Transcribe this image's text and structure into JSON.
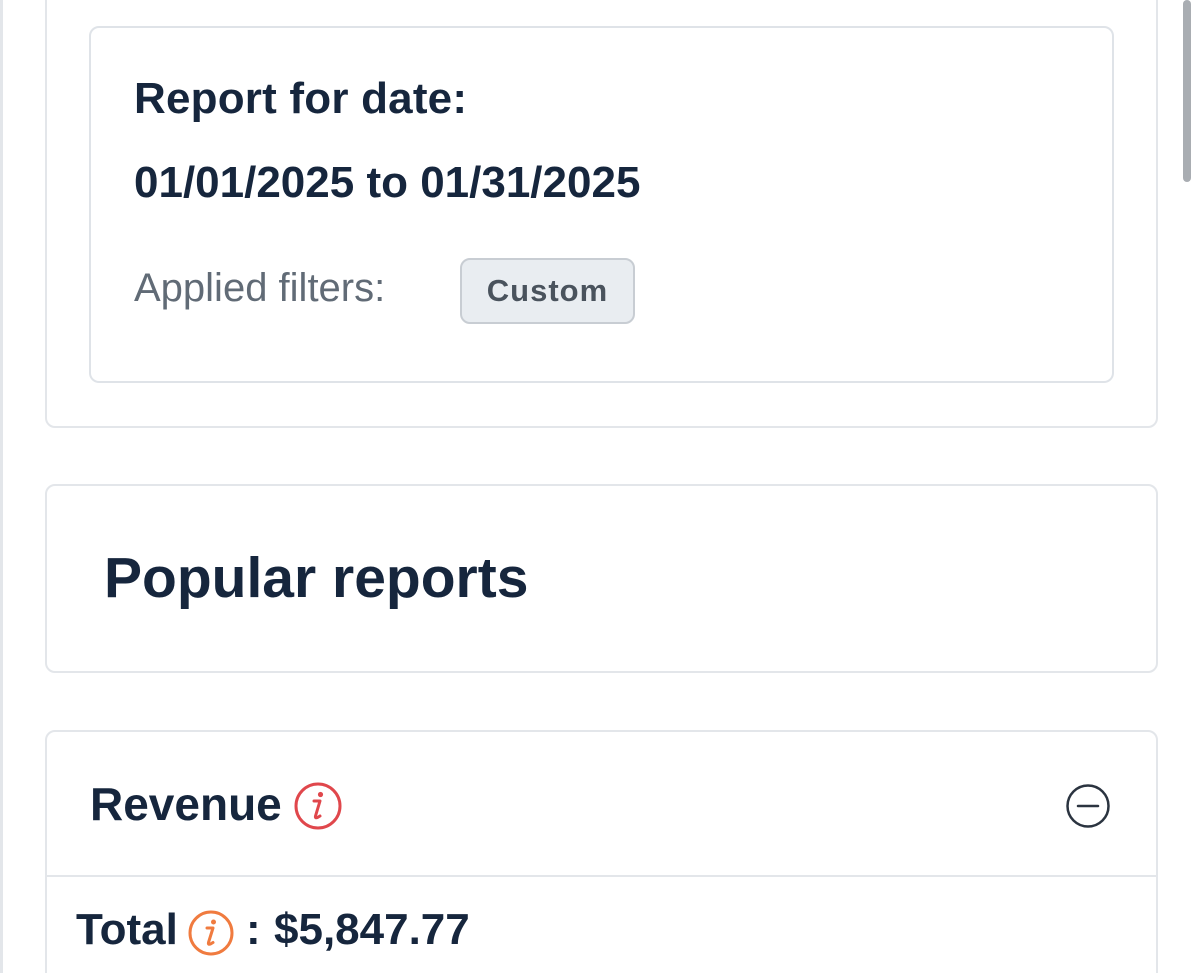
{
  "report": {
    "label": "Report for date:",
    "range": "01/01/2025 to 01/31/2025",
    "filters_label": "Applied filters:",
    "filter_chip": "Custom"
  },
  "popular": {
    "title": "Popular reports"
  },
  "revenue": {
    "title": "Revenue",
    "total_label": "Total",
    "colon": ":",
    "total_value": "$5,847.77",
    "info_icon": "info-icon",
    "collapse_icon": "minus-circle-icon"
  },
  "colors": {
    "text_primary": "#16263d",
    "text_muted": "#616b76",
    "info_red": "#e0474c",
    "info_orange": "#f07b3f",
    "border": "#e3e6ea",
    "chip_bg": "#e9edf1"
  }
}
